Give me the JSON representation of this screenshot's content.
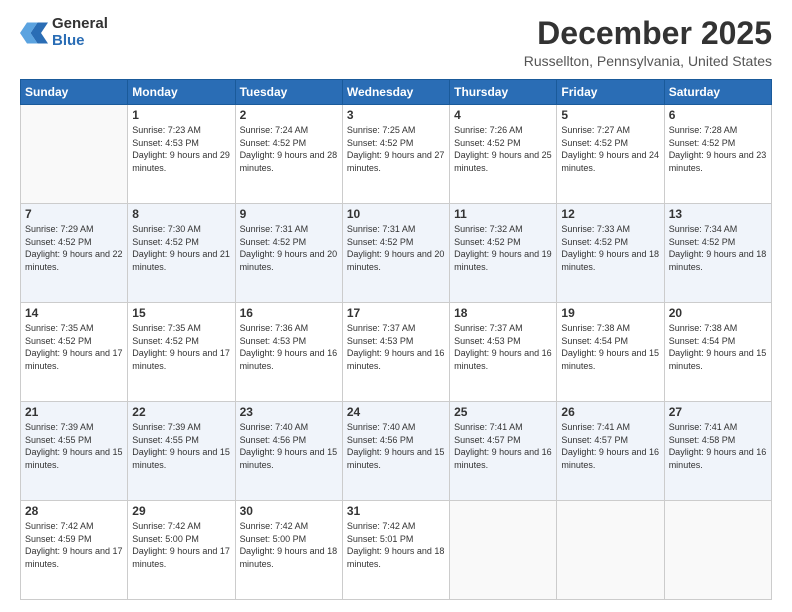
{
  "header": {
    "logo_general": "General",
    "logo_blue": "Blue",
    "month_title": "December 2025",
    "location": "Russellton, Pennsylvania, United States"
  },
  "days_of_week": [
    "Sunday",
    "Monday",
    "Tuesday",
    "Wednesday",
    "Thursday",
    "Friday",
    "Saturday"
  ],
  "weeks": [
    [
      {
        "day": "",
        "sunrise": "",
        "sunset": "",
        "daylight": ""
      },
      {
        "day": "1",
        "sunrise": "Sunrise: 7:23 AM",
        "sunset": "Sunset: 4:53 PM",
        "daylight": "Daylight: 9 hours and 29 minutes."
      },
      {
        "day": "2",
        "sunrise": "Sunrise: 7:24 AM",
        "sunset": "Sunset: 4:52 PM",
        "daylight": "Daylight: 9 hours and 28 minutes."
      },
      {
        "day": "3",
        "sunrise": "Sunrise: 7:25 AM",
        "sunset": "Sunset: 4:52 PM",
        "daylight": "Daylight: 9 hours and 27 minutes."
      },
      {
        "day": "4",
        "sunrise": "Sunrise: 7:26 AM",
        "sunset": "Sunset: 4:52 PM",
        "daylight": "Daylight: 9 hours and 25 minutes."
      },
      {
        "day": "5",
        "sunrise": "Sunrise: 7:27 AM",
        "sunset": "Sunset: 4:52 PM",
        "daylight": "Daylight: 9 hours and 24 minutes."
      },
      {
        "day": "6",
        "sunrise": "Sunrise: 7:28 AM",
        "sunset": "Sunset: 4:52 PM",
        "daylight": "Daylight: 9 hours and 23 minutes."
      }
    ],
    [
      {
        "day": "7",
        "sunrise": "Sunrise: 7:29 AM",
        "sunset": "Sunset: 4:52 PM",
        "daylight": "Daylight: 9 hours and 22 minutes."
      },
      {
        "day": "8",
        "sunrise": "Sunrise: 7:30 AM",
        "sunset": "Sunset: 4:52 PM",
        "daylight": "Daylight: 9 hours and 21 minutes."
      },
      {
        "day": "9",
        "sunrise": "Sunrise: 7:31 AM",
        "sunset": "Sunset: 4:52 PM",
        "daylight": "Daylight: 9 hours and 20 minutes."
      },
      {
        "day": "10",
        "sunrise": "Sunrise: 7:31 AM",
        "sunset": "Sunset: 4:52 PM",
        "daylight": "Daylight: 9 hours and 20 minutes."
      },
      {
        "day": "11",
        "sunrise": "Sunrise: 7:32 AM",
        "sunset": "Sunset: 4:52 PM",
        "daylight": "Daylight: 9 hours and 19 minutes."
      },
      {
        "day": "12",
        "sunrise": "Sunrise: 7:33 AM",
        "sunset": "Sunset: 4:52 PM",
        "daylight": "Daylight: 9 hours and 18 minutes."
      },
      {
        "day": "13",
        "sunrise": "Sunrise: 7:34 AM",
        "sunset": "Sunset: 4:52 PM",
        "daylight": "Daylight: 9 hours and 18 minutes."
      }
    ],
    [
      {
        "day": "14",
        "sunrise": "Sunrise: 7:35 AM",
        "sunset": "Sunset: 4:52 PM",
        "daylight": "Daylight: 9 hours and 17 minutes."
      },
      {
        "day": "15",
        "sunrise": "Sunrise: 7:35 AM",
        "sunset": "Sunset: 4:52 PM",
        "daylight": "Daylight: 9 hours and 17 minutes."
      },
      {
        "day": "16",
        "sunrise": "Sunrise: 7:36 AM",
        "sunset": "Sunset: 4:53 PM",
        "daylight": "Daylight: 9 hours and 16 minutes."
      },
      {
        "day": "17",
        "sunrise": "Sunrise: 7:37 AM",
        "sunset": "Sunset: 4:53 PM",
        "daylight": "Daylight: 9 hours and 16 minutes."
      },
      {
        "day": "18",
        "sunrise": "Sunrise: 7:37 AM",
        "sunset": "Sunset: 4:53 PM",
        "daylight": "Daylight: 9 hours and 16 minutes."
      },
      {
        "day": "19",
        "sunrise": "Sunrise: 7:38 AM",
        "sunset": "Sunset: 4:54 PM",
        "daylight": "Daylight: 9 hours and 15 minutes."
      },
      {
        "day": "20",
        "sunrise": "Sunrise: 7:38 AM",
        "sunset": "Sunset: 4:54 PM",
        "daylight": "Daylight: 9 hours and 15 minutes."
      }
    ],
    [
      {
        "day": "21",
        "sunrise": "Sunrise: 7:39 AM",
        "sunset": "Sunset: 4:55 PM",
        "daylight": "Daylight: 9 hours and 15 minutes."
      },
      {
        "day": "22",
        "sunrise": "Sunrise: 7:39 AM",
        "sunset": "Sunset: 4:55 PM",
        "daylight": "Daylight: 9 hours and 15 minutes."
      },
      {
        "day": "23",
        "sunrise": "Sunrise: 7:40 AM",
        "sunset": "Sunset: 4:56 PM",
        "daylight": "Daylight: 9 hours and 15 minutes."
      },
      {
        "day": "24",
        "sunrise": "Sunrise: 7:40 AM",
        "sunset": "Sunset: 4:56 PM",
        "daylight": "Daylight: 9 hours and 15 minutes."
      },
      {
        "day": "25",
        "sunrise": "Sunrise: 7:41 AM",
        "sunset": "Sunset: 4:57 PM",
        "daylight": "Daylight: 9 hours and 16 minutes."
      },
      {
        "day": "26",
        "sunrise": "Sunrise: 7:41 AM",
        "sunset": "Sunset: 4:57 PM",
        "daylight": "Daylight: 9 hours and 16 minutes."
      },
      {
        "day": "27",
        "sunrise": "Sunrise: 7:41 AM",
        "sunset": "Sunset: 4:58 PM",
        "daylight": "Daylight: 9 hours and 16 minutes."
      }
    ],
    [
      {
        "day": "28",
        "sunrise": "Sunrise: 7:42 AM",
        "sunset": "Sunset: 4:59 PM",
        "daylight": "Daylight: 9 hours and 17 minutes."
      },
      {
        "day": "29",
        "sunrise": "Sunrise: 7:42 AM",
        "sunset": "Sunset: 5:00 PM",
        "daylight": "Daylight: 9 hours and 17 minutes."
      },
      {
        "day": "30",
        "sunrise": "Sunrise: 7:42 AM",
        "sunset": "Sunset: 5:00 PM",
        "daylight": "Daylight: 9 hours and 18 minutes."
      },
      {
        "day": "31",
        "sunrise": "Sunrise: 7:42 AM",
        "sunset": "Sunset: 5:01 PM",
        "daylight": "Daylight: 9 hours and 18 minutes."
      },
      {
        "day": "",
        "sunrise": "",
        "sunset": "",
        "daylight": ""
      },
      {
        "day": "",
        "sunrise": "",
        "sunset": "",
        "daylight": ""
      },
      {
        "day": "",
        "sunrise": "",
        "sunset": "",
        "daylight": ""
      }
    ]
  ]
}
